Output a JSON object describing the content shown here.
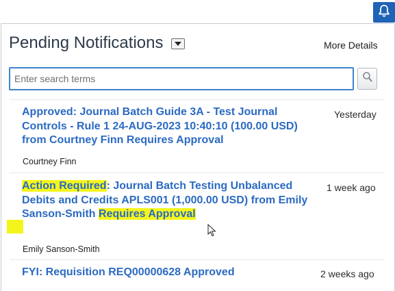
{
  "header": {
    "bell_icon": "bell-icon",
    "bell_color": "#1f63b6"
  },
  "panel": {
    "title": "Pending Notifications",
    "more_details": "More Details"
  },
  "search": {
    "value": "",
    "placeholder": "Enter search terms",
    "icon": "search-icon"
  },
  "notifications": [
    {
      "title": "Approved: Journal Batch Guide 3A - Test Journal Controls - Rule 1 24-AUG-2023 10:40:10 (100.00 USD) from Courtney Finn Requires Approval",
      "time": "Yesterday",
      "sender": "Courtney Finn"
    },
    {
      "title_highlight": "Action Required",
      "title_rest": ": Journal Batch Testing Unbalanced Debits and Credits APLS001 (1,000.00 USD) from Emily Sanson-Smith ",
      "title_highlight_end": "Requires Approval",
      "time": "1 week ago",
      "sender": "Emily Sanson-Smith"
    },
    {
      "title": "FYI: Requisition REQ00000628 Approved",
      "time": "2 weeks ago"
    }
  ],
  "colors": {
    "link": "#2b6ac2",
    "highlight": "#f4f51c",
    "accent": "#3a84ce"
  }
}
